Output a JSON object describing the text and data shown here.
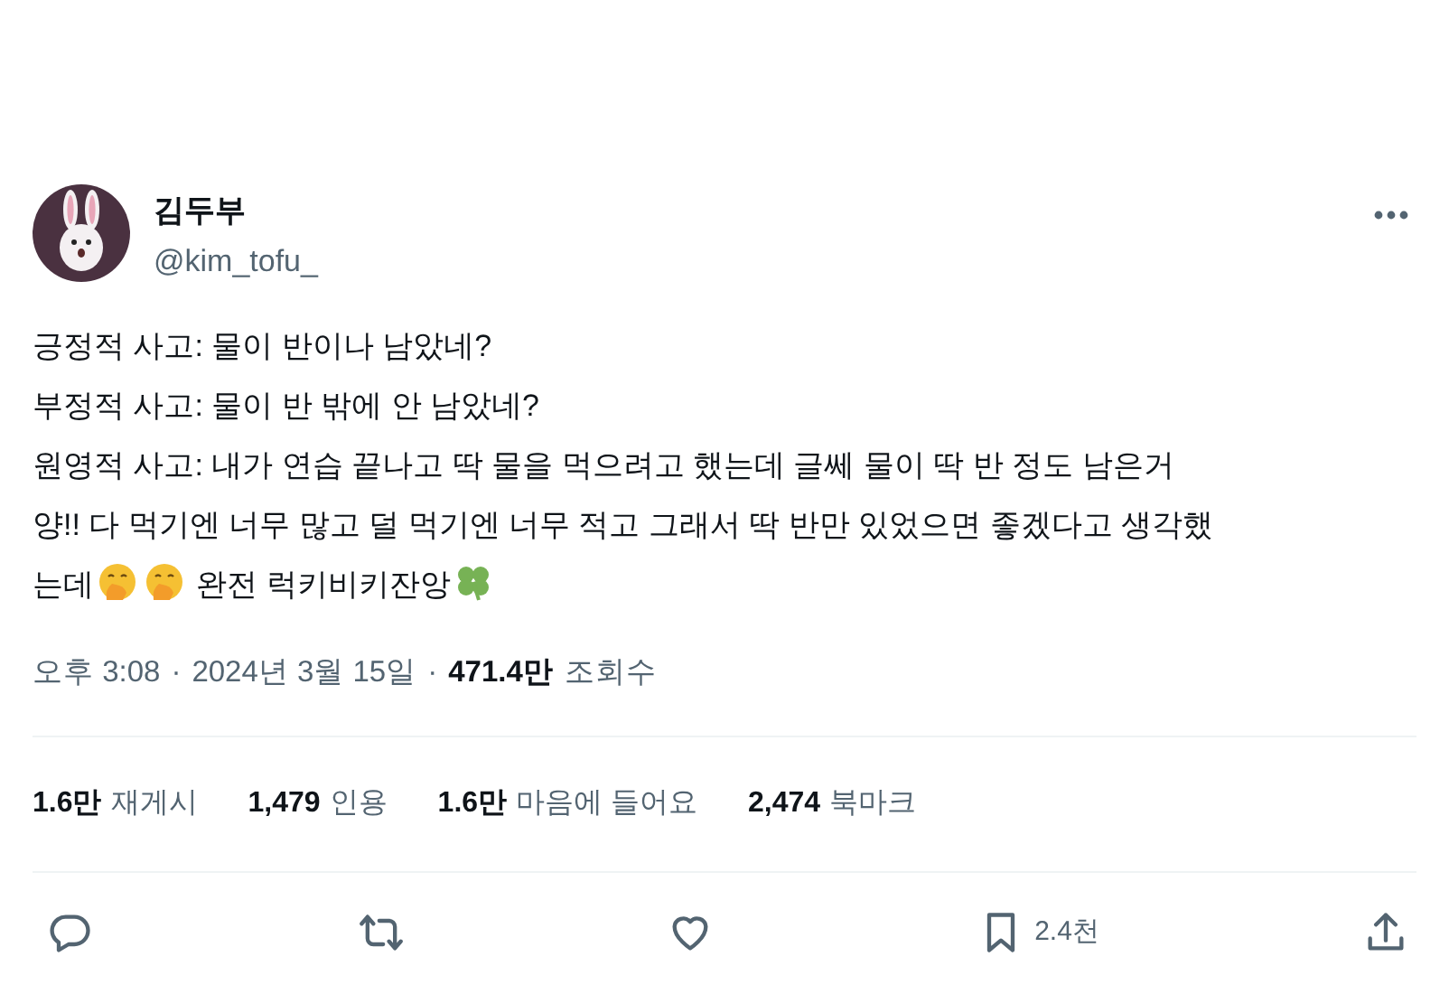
{
  "author": {
    "name": "김두부",
    "handle": "@kim_tofu_"
  },
  "paragraphs": [
    {
      "parts": [
        "긍정적 사고: 물이 반이나 남았네?"
      ]
    },
    {
      "parts": [
        "부정적 사고: 물이 반 밖에 안 남았네?"
      ]
    },
    {
      "parts": [
        "원영적 사고: 내가 연습 끝나고 딱 물을 먹으려고 했는데 글쎄 물이 딱 반 정도 남은거"
      ]
    },
    {
      "parts": [
        "양!! 다 먹기엔 너무 많고 덜 먹기엔 너무 적고 그래서 딱 반만 있었으면 좋겠다고 생각했"
      ]
    },
    {
      "parts": [
        "는데",
        "완전 럭키비키잔앙"
      ]
    }
  ],
  "meta": {
    "time": "오후 3:08",
    "separator_1": "·",
    "date": "2024년 3월 15일",
    "separator_2": "·",
    "views": "471.4만",
    "views_label": "조회수"
  },
  "stats": [
    {
      "count": "1.6만",
      "label": "재게시"
    },
    {
      "count": "1,479",
      "label": "인용"
    },
    {
      "count": "1.6만",
      "label": "마음에 들어요"
    },
    {
      "count": "2,474",
      "label": "북마크"
    }
  ],
  "actions": [
    {
      "kind": "reply"
    },
    {
      "kind": "repost"
    },
    {
      "kind": "like"
    },
    {
      "kind": "bookmark",
      "count": "2.4천"
    },
    {
      "kind": "share"
    }
  ]
}
